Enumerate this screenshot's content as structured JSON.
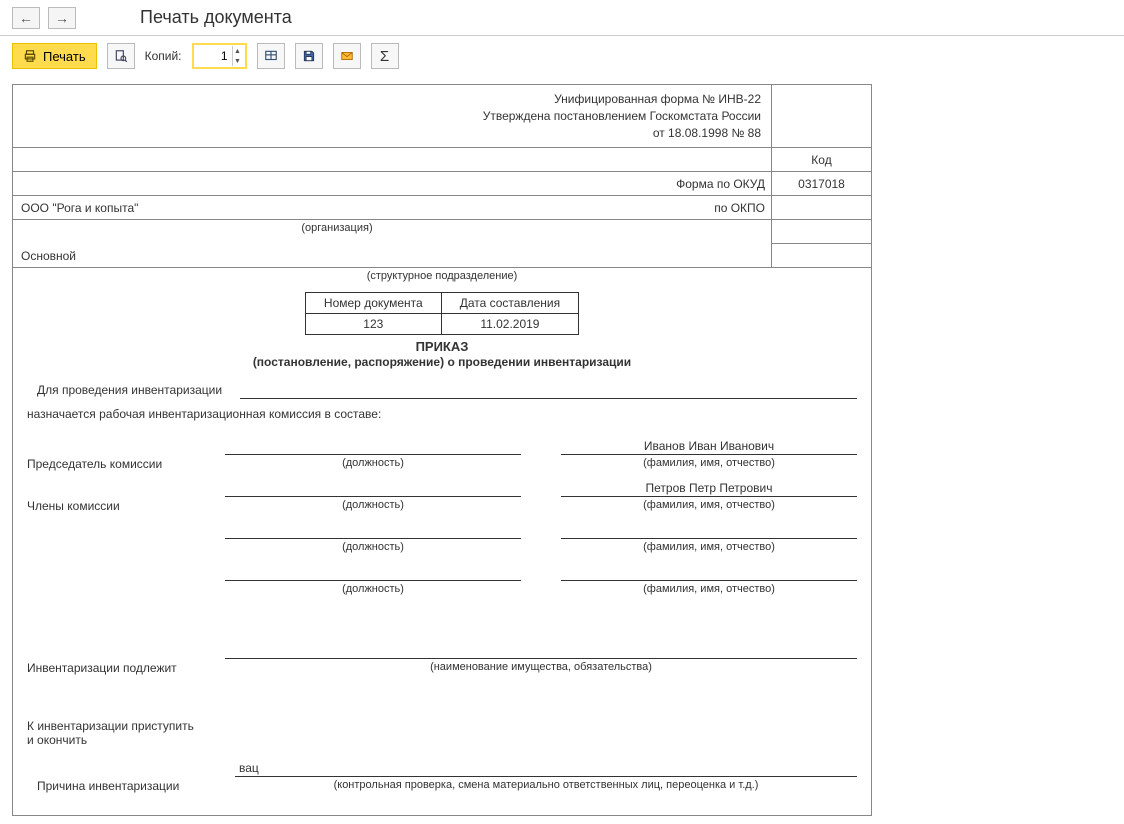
{
  "header": {
    "title": "Печать документа"
  },
  "toolbar": {
    "print": "Печать",
    "copies_label": "Копий:",
    "copies_value": "1"
  },
  "doc": {
    "form_line1": "Унифицированная форма № ИНВ-22",
    "form_line2": "Утверждена постановлением Госкомстата России",
    "form_line3": "от 18.08.1998 № 88",
    "code_header": "Код",
    "okud_label": "Форма по ОКУД",
    "okud_value": "0317018",
    "org_name": "ООО \"Рога и копыта\"",
    "okpo_label": "по ОКПО",
    "okpo_value": "",
    "org_caption": "(организация)",
    "division": "Основной",
    "division_caption": "(структурное подразделение)",
    "tbl_num_header": "Номер документа",
    "tbl_date_header": "Дата составления",
    "tbl_num": "123",
    "tbl_date": "11.02.2019",
    "order_word": "ПРИКАЗ",
    "order_sub": "(постановление, распоряжение) о проведении инвентаризации",
    "p_intro": "Для проведения инвентаризации",
    "p_commission": "назначается рабочая инвентаризационная комиссия в составе:",
    "chairman_label": "Председатель комиссии",
    "members_label": "Члены комиссии",
    "position_caption": "(должность)",
    "fio_caption": "(фамилия, имя, отчество)",
    "chairman_fio": "Иванов Иван Иванович",
    "member1_fio": "Петров Петр Петрович",
    "subject_label": "Инвентаризации подлежит",
    "subject_caption": "(наименование имущества, обязательства)",
    "start_label1": "К инвентаризации приступить",
    "start_label2": "и окончить",
    "reason_label": "Причина инвентаризации",
    "reason_value": "вац",
    "reason_caption": "(контрольная проверка, смена материально ответственных лиц, переоценка и т.д.)"
  }
}
